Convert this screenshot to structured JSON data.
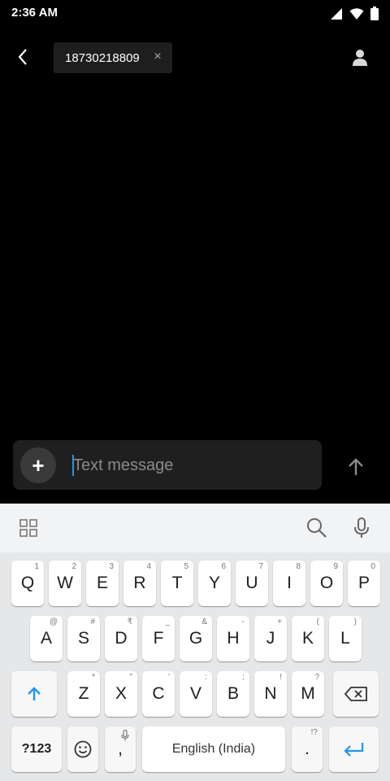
{
  "status_bar": {
    "time": "2:36 AM"
  },
  "header": {
    "recipient": "18730218809",
    "recipient_remove": "×"
  },
  "composer": {
    "placeholder": "Text message",
    "attach_symbol": "+"
  },
  "keyboard": {
    "row1": [
      {
        "label": "Q",
        "hint": "1"
      },
      {
        "label": "W",
        "hint": "2"
      },
      {
        "label": "E",
        "hint": "3"
      },
      {
        "label": "R",
        "hint": "4"
      },
      {
        "label": "T",
        "hint": "5"
      },
      {
        "label": "Y",
        "hint": "6"
      },
      {
        "label": "U",
        "hint": "7"
      },
      {
        "label": "I",
        "hint": "8"
      },
      {
        "label": "O",
        "hint": "9"
      },
      {
        "label": "P",
        "hint": "0"
      }
    ],
    "row2": [
      {
        "label": "A",
        "hint": "@"
      },
      {
        "label": "S",
        "hint": "#"
      },
      {
        "label": "D",
        "hint": "₹"
      },
      {
        "label": "F",
        "hint": "_"
      },
      {
        "label": "G",
        "hint": "&"
      },
      {
        "label": "H",
        "hint": "-"
      },
      {
        "label": "J",
        "hint": "+"
      },
      {
        "label": "K",
        "hint": "("
      },
      {
        "label": "L",
        "hint": ")"
      }
    ],
    "row3": [
      {
        "label": "Z",
        "hint": "*"
      },
      {
        "label": "X",
        "hint": "\""
      },
      {
        "label": "C",
        "hint": "'"
      },
      {
        "label": "V",
        "hint": ":"
      },
      {
        "label": "B",
        "hint": ";"
      },
      {
        "label": "N",
        "hint": "!"
      },
      {
        "label": "M",
        "hint": "?"
      }
    ],
    "symbols_label": "?123",
    "comma_label": ",",
    "space_label": "English (India)",
    "period_label": ".",
    "period_hint": "!?"
  },
  "colors": {
    "accent": "#2196f3",
    "background": "#000000",
    "keyboard_bg": "#e6e7e9"
  }
}
